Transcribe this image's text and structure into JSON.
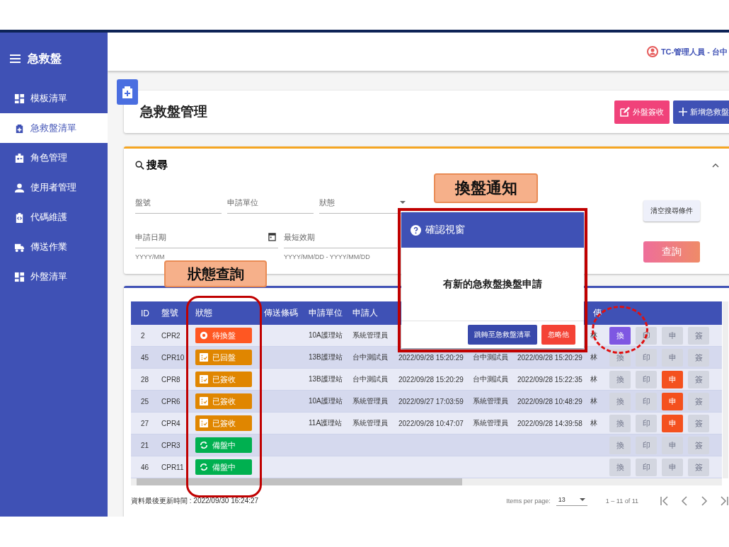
{
  "sidebar": {
    "title": "急救盤",
    "items": [
      {
        "label": "模板清單",
        "selected": false
      },
      {
        "label": "急救盤清單",
        "selected": true
      },
      {
        "label": "角色管理",
        "selected": false
      },
      {
        "label": "使用者管理",
        "selected": false
      },
      {
        "label": "代碼維護",
        "selected": false
      },
      {
        "label": "傳送作業",
        "selected": false
      },
      {
        "label": "外盤清單",
        "selected": false
      }
    ]
  },
  "topbar": {
    "user": "TC-管理人員 - 台中"
  },
  "page": {
    "title": "急救盤管理",
    "buttons": [
      {
        "label": "外盤簽收",
        "kind": "sign"
      },
      {
        "label": "新增急救盤",
        "kind": "add"
      }
    ]
  },
  "search": {
    "title": "搜尋",
    "fields": [
      {
        "label": "盤號",
        "kind": "text"
      },
      {
        "label": "申請單位",
        "kind": "text"
      },
      {
        "label": "狀態",
        "kind": "select"
      },
      {
        "label": "申請日期",
        "kind": "date",
        "placeholder": "YYYY/MM"
      },
      {
        "label": "最短效期",
        "kind": "text",
        "placeholder": "YYYY/MM/DD - YYYY/MM/DD"
      }
    ],
    "clear_button": "清空搜尋條件",
    "query_button": "查詢"
  },
  "table": {
    "columns": [
      "ID",
      "盤號",
      "狀態",
      "傳送條碼",
      "申請單位",
      "申請人",
      "",
      "",
      "",
      "傳"
    ],
    "rows": [
      {
        "id": "2",
        "tray": "CPR2",
        "status": {
          "label": "待換盤",
          "kind": "pending"
        },
        "unit": "10A護理站",
        "applicant": "系統管理員",
        "column_10": "林",
        "actions": [
          {
            "label": "換",
            "enabled": true
          },
          {
            "label": "印",
            "enabled": false
          },
          {
            "label": "申",
            "enabled": false
          },
          {
            "label": "簽",
            "enabled": false
          }
        ]
      },
      {
        "id": "45",
        "tray": "CPR10",
        "status": {
          "label": "已回盤",
          "kind": "done"
        },
        "unit": "13B護理站",
        "applicant": "台中測試員",
        "column_7": "2022/09/28 15:20:29",
        "column_8": "台中測試員",
        "column_9": "2022/09/28 15:20:29",
        "column_10": "林",
        "actions": [
          {
            "label": "換",
            "enabled": false
          },
          {
            "label": "印",
            "enabled": false
          },
          {
            "label": "申",
            "enabled": false
          },
          {
            "label": "簽",
            "enabled": false
          }
        ]
      },
      {
        "id": "28",
        "tray": "CPR8",
        "status": {
          "label": "已簽收",
          "kind": "done"
        },
        "unit": "13B護理站",
        "applicant": "台中測試員",
        "column_7": "2022/09/28 15:20:29",
        "column_8": "台中測試員",
        "column_9": "2022/09/28 15:22:35",
        "column_10": "林",
        "actions": [
          {
            "label": "換",
            "enabled": false
          },
          {
            "label": "印",
            "enabled": false
          },
          {
            "label": "申",
            "enabled": true
          },
          {
            "label": "簽",
            "enabled": false
          }
        ]
      },
      {
        "id": "25",
        "tray": "CPR6",
        "status": {
          "label": "已簽收",
          "kind": "done"
        },
        "unit": "10A護理站",
        "applicant": "系統管理員",
        "column_7": "2022/09/27 17:03:59",
        "column_8": "系統管理員",
        "column_9": "2022/09/28 10:48:29",
        "column_10": "林",
        "actions": [
          {
            "label": "換",
            "enabled": false
          },
          {
            "label": "印",
            "enabled": false
          },
          {
            "label": "申",
            "enabled": true
          },
          {
            "label": "簽",
            "enabled": false
          }
        ]
      },
      {
        "id": "27",
        "tray": "CPR4",
        "status": {
          "label": "已簽收",
          "kind": "done"
        },
        "unit": "11A護理站",
        "applicant": "系統管理員",
        "column_7": "2022/09/28 10:47:07",
        "column_8": "系統管理員",
        "column_9": "2022/09/28 14:39:58",
        "column_10": "林",
        "actions": [
          {
            "label": "換",
            "enabled": false
          },
          {
            "label": "印",
            "enabled": false
          },
          {
            "label": "申",
            "enabled": true
          },
          {
            "label": "簽",
            "enabled": false
          }
        ]
      },
      {
        "id": "21",
        "tray": "CPR3",
        "status": {
          "label": "備盤中",
          "kind": "preparing"
        },
        "actions": [
          {
            "label": "換",
            "enabled": false
          },
          {
            "label": "印",
            "enabled": false
          },
          {
            "label": "申",
            "enabled": false
          },
          {
            "label": "簽",
            "enabled": false
          }
        ]
      },
      {
        "id": "46",
        "tray": "CPR11",
        "status": {
          "label": "備盤中",
          "kind": "preparing"
        },
        "actions": [
          {
            "label": "換",
            "enabled": false
          },
          {
            "label": "印",
            "enabled": false
          },
          {
            "label": "申",
            "enabled": false
          },
          {
            "label": "簽",
            "enabled": false
          }
        ]
      }
    ]
  },
  "footer": {
    "updated": "資料最後更新時間 : 2022/09/30 16:24:27",
    "items_per_page_label": "Items per page:",
    "items_per_page": "13",
    "range": "1 – 11 of 11"
  },
  "dialog": {
    "title": "確認視窗",
    "message": "有新的急救盤換盤申請",
    "buttons": [
      {
        "label": "跳轉至急救盤清單",
        "kind": "primary"
      },
      {
        "label": "忽略他",
        "kind": "danger"
      }
    ]
  },
  "annotations": [
    {
      "kind": "callout",
      "text": "狀態查詢"
    },
    {
      "kind": "callout",
      "text": "換盤通知"
    },
    {
      "kind": "rounded-frame"
    },
    {
      "kind": "frame"
    },
    {
      "kind": "dashed-circle"
    }
  ]
}
